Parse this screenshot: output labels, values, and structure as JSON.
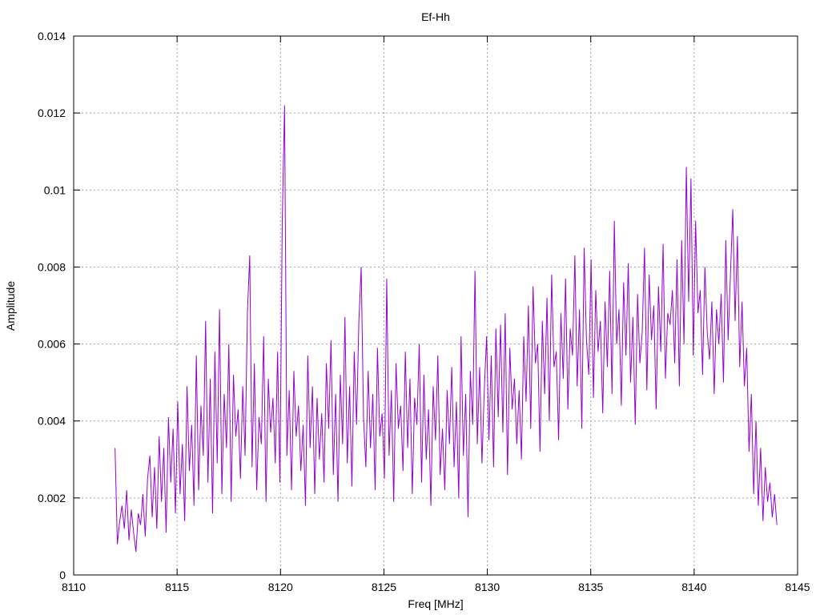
{
  "chart_data": {
    "type": "line",
    "title": "Ef-Hh",
    "xlabel": "Freq [MHz]",
    "ylabel": "Amplitude",
    "xlim": [
      8110,
      8145
    ],
    "ylim": [
      0,
      0.014
    ],
    "xticks": [
      "8110",
      "8115",
      "8120",
      "8125",
      "8130",
      "8135",
      "8140",
      "8145"
    ],
    "yticks": [
      "0",
      "0.002",
      "0.004",
      "0.006",
      "0.008",
      "0.01",
      "0.012",
      "0.014"
    ],
    "grid": true,
    "legend": "none",
    "series": [
      {
        "color": "#9400d3",
        "x_start": 8112.0,
        "x_end": 8144.0,
        "values": [
          0.0033,
          0.0008,
          0.0014,
          0.0018,
          0.0012,
          0.0022,
          0.0009,
          0.0017,
          0.0011,
          0.0006,
          0.0016,
          0.0013,
          0.0021,
          0.001,
          0.0025,
          0.0031,
          0.0015,
          0.0028,
          0.0012,
          0.0036,
          0.0019,
          0.0033,
          0.0011,
          0.0041,
          0.0024,
          0.0038,
          0.0016,
          0.0045,
          0.0021,
          0.0034,
          0.0014,
          0.0049,
          0.0027,
          0.0039,
          0.0018,
          0.0057,
          0.0022,
          0.0044,
          0.0031,
          0.0066,
          0.0024,
          0.0051,
          0.0016,
          0.0058,
          0.0029,
          0.0069,
          0.0021,
          0.0047,
          0.0033,
          0.006,
          0.0019,
          0.0052,
          0.0036,
          0.0043,
          0.0025,
          0.0049,
          0.0031,
          0.0068,
          0.0083,
          0.0028,
          0.0055,
          0.0022,
          0.0041,
          0.0034,
          0.0062,
          0.0019,
          0.0051,
          0.0037,
          0.0046,
          0.0029,
          0.0058,
          0.0024,
          0.0092,
          0.0122,
          0.0031,
          0.0048,
          0.0022,
          0.0053,
          0.0036,
          0.0044,
          0.0027,
          0.0039,
          0.0018,
          0.0057,
          0.0033,
          0.0049,
          0.0021,
          0.0046,
          0.003,
          0.0042,
          0.0024,
          0.0055,
          0.0038,
          0.0061,
          0.0026,
          0.0047,
          0.0019,
          0.0052,
          0.0034,
          0.0067,
          0.0029,
          0.0049,
          0.0023,
          0.0058,
          0.0039,
          0.0066,
          0.008,
          0.0041,
          0.0028,
          0.0053,
          0.0033,
          0.0047,
          0.0022,
          0.0059,
          0.0036,
          0.0042,
          0.0025,
          0.0077,
          0.0031,
          0.0048,
          0.0019,
          0.0055,
          0.0038,
          0.0044,
          0.0027,
          0.0058,
          0.0033,
          0.0051,
          0.0021,
          0.0046,
          0.0039,
          0.006,
          0.0024,
          0.0052,
          0.003,
          0.0043,
          0.0018,
          0.0049,
          0.0035,
          0.0057,
          0.0026,
          0.0038,
          0.0022,
          0.0048,
          0.0034,
          0.0054,
          0.0028,
          0.0045,
          0.002,
          0.0062,
          0.0031,
          0.0047,
          0.0015,
          0.0053,
          0.0039,
          0.0079,
          0.0034,
          0.0054,
          0.0029,
          0.0048,
          0.0062,
          0.0035,
          0.0057,
          0.0028,
          0.0064,
          0.0041,
          0.0065,
          0.0037,
          0.0068,
          0.0026,
          0.0059,
          0.0043,
          0.0051,
          0.0034,
          0.0048,
          0.003,
          0.0062,
          0.0045,
          0.007,
          0.0038,
          0.0075,
          0.0055,
          0.006,
          0.0032,
          0.0066,
          0.0047,
          0.0072,
          0.004,
          0.0078,
          0.0054,
          0.0058,
          0.0035,
          0.0068,
          0.0051,
          0.0077,
          0.0043,
          0.0064,
          0.0057,
          0.0083,
          0.0049,
          0.0069,
          0.0038,
          0.0085,
          0.0061,
          0.0052,
          0.0082,
          0.0046,
          0.0074,
          0.0058,
          0.0066,
          0.0042,
          0.0071,
          0.0054,
          0.0079,
          0.0047,
          0.0092,
          0.006,
          0.0069,
          0.0044,
          0.0076,
          0.0057,
          0.0081,
          0.005,
          0.0067,
          0.0039,
          0.0073,
          0.0055,
          0.0063,
          0.0085,
          0.0048,
          0.0078,
          0.0061,
          0.007,
          0.0043,
          0.0075,
          0.0058,
          0.0086,
          0.0051,
          0.0068,
          0.0065,
          0.0074,
          0.0055,
          0.0082,
          0.0049,
          0.0087,
          0.006,
          0.0106,
          0.0071,
          0.0103,
          0.0057,
          0.0092,
          0.0068,
          0.0074,
          0.0052,
          0.008,
          0.0063,
          0.0056,
          0.0071,
          0.0047,
          0.0069,
          0.006,
          0.0073,
          0.005,
          0.0087,
          0.0061,
          0.0078,
          0.0095,
          0.0066,
          0.0088,
          0.0054,
          0.0071,
          0.0049,
          0.0059,
          0.0032,
          0.0047,
          0.0021,
          0.004,
          0.0018,
          0.0033,
          0.0014,
          0.0028,
          0.0019,
          0.0024,
          0.0015,
          0.0021,
          0.0013
        ]
      }
    ]
  }
}
